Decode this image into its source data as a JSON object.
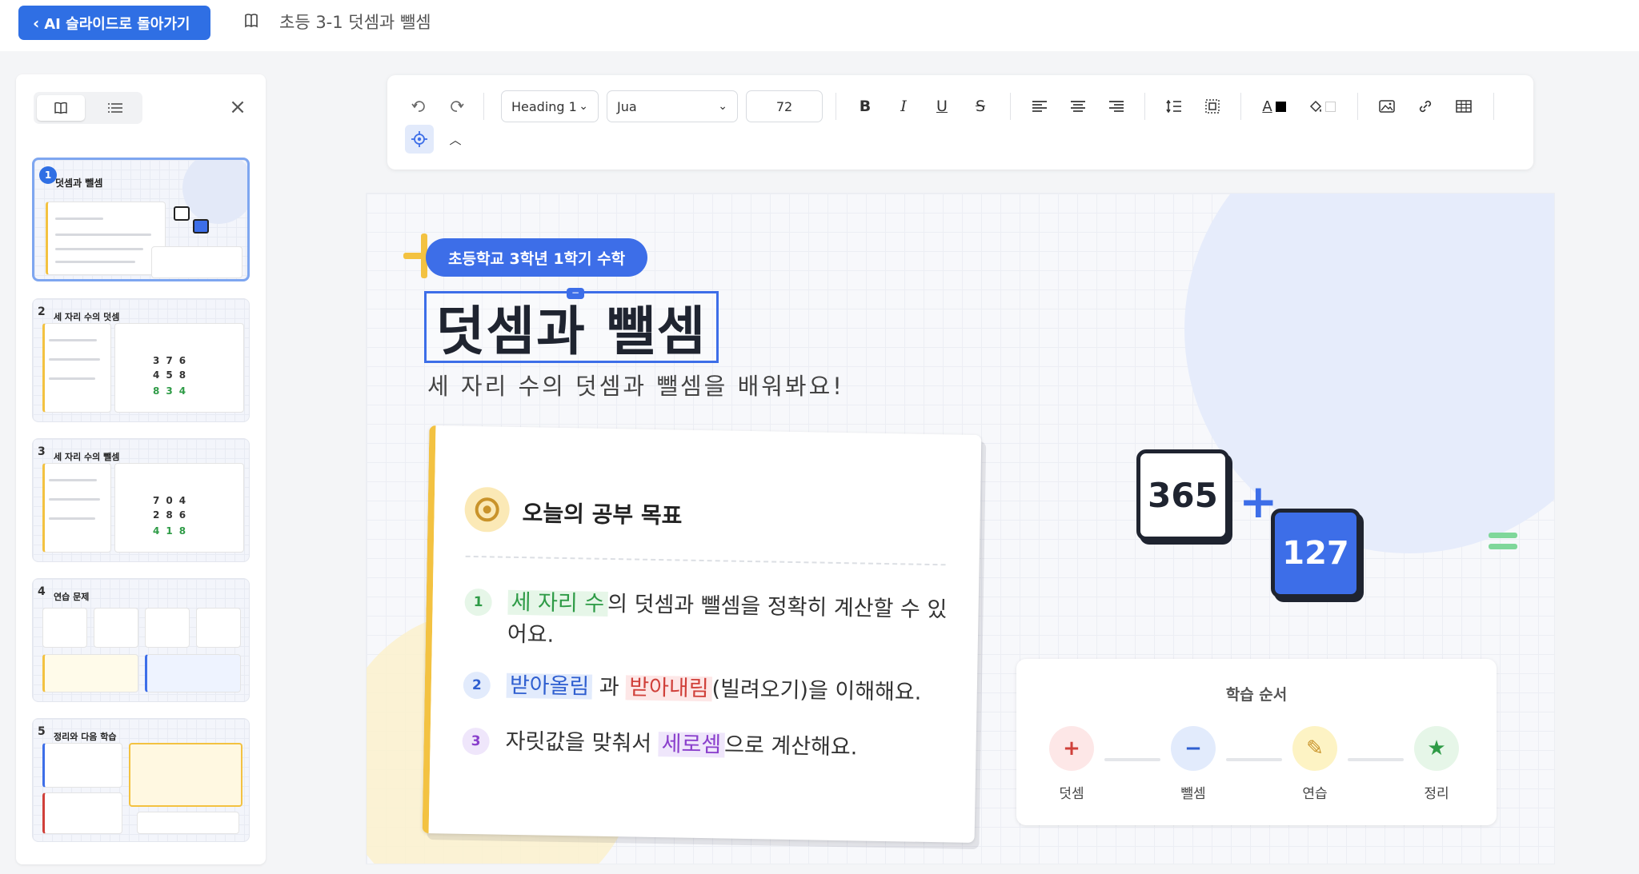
{
  "topbar": {
    "back_label": "AI 슬라이드로 돌아가기",
    "doc_title": "초등 3-1 덧셈과 뺄셈"
  },
  "toolbar": {
    "heading_select": "Heading 1",
    "font_select": "Jua",
    "font_size": "72",
    "icons": [
      "undo-icon",
      "redo-icon",
      "bold-icon",
      "italic-icon",
      "underline-icon",
      "strikethrough-icon",
      "align-left-icon",
      "align-center-icon",
      "align-right-icon",
      "line-height-icon",
      "padding-icon",
      "text-color-icon",
      "fill-color-icon",
      "image-icon",
      "link-icon",
      "table-icon",
      "target-icon",
      "chevron-up-icon"
    ],
    "text_color": "#000000",
    "fill_color": "#ffffff"
  },
  "sidebar": {
    "thumbnails": [
      {
        "num": "1",
        "title": "덧셈과 뺄셈",
        "selected": true
      },
      {
        "num": "2",
        "title": "세 자리 수의 덧셈",
        "selected": false
      },
      {
        "num": "3",
        "title": "세 자리 수의 뺄셈",
        "selected": false
      },
      {
        "num": "4",
        "title": "연습 문제",
        "selected": false
      },
      {
        "num": "5",
        "title": "정리와 다음 학습",
        "selected": false
      }
    ]
  },
  "slide": {
    "subject_pill": "초등학교 3학년 1학기 수학",
    "title": "덧셈과 뺄셈",
    "subtitle": "세 자리 수의 덧셈과 뺄셈을 배워봐요!",
    "goal_card": {
      "title": "오늘의 공부 목표",
      "items": [
        {
          "num": "1",
          "highlight": "세 자리 수",
          "text": "의 덧셈과 뺄셈을 정확히 계산할 수 있어요."
        },
        {
          "num": "2",
          "highlight1": "받아올림",
          "mid": "과",
          "highlight2": "받아내림",
          "text": "(빌려오기)을 이해해요."
        },
        {
          "num": "3",
          "pre": "자릿값을 맞춰서",
          "highlight": "세로셈",
          "text": "으로 계산해요."
        }
      ]
    },
    "math": {
      "a": "365",
      "op": "+",
      "b": "127"
    },
    "steps": {
      "title": "학습 순서",
      "items": [
        {
          "label": "덧셈",
          "symbol": "+"
        },
        {
          "label": "뺄셈",
          "symbol": "−"
        },
        {
          "label": "연습",
          "symbol": "✎"
        },
        {
          "label": "정리",
          "symbol": "★"
        }
      ]
    }
  },
  "colors": {
    "accent": "#2f6fe4",
    "yellow": "#f3c241",
    "green": "#2e9b46",
    "red": "#d0403a",
    "purple": "#8a3fcc"
  }
}
